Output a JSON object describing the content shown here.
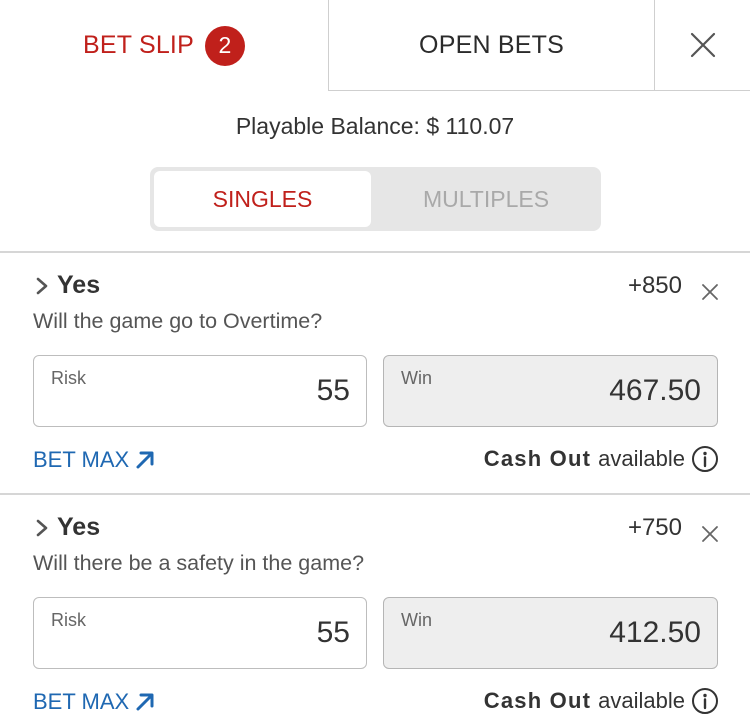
{
  "tabs": {
    "bet_slip_label": "BET SLIP",
    "bet_slip_count": "2",
    "open_bets_label": "OPEN BETS",
    "close_icon": "close-icon"
  },
  "balance": {
    "text": "Playable Balance: $ 110.07"
  },
  "mode_toggle": {
    "singles_label": "SINGLES",
    "multiples_label": "MULTIPLES",
    "selected": "SINGLES"
  },
  "bets": [
    {
      "selection": "Yes",
      "odds": "+850",
      "question": "Will the game go to Overtime?",
      "risk_label": "Risk",
      "risk_value": "55",
      "win_label": "Win",
      "win_value": "467.50",
      "bet_max_label": "BET MAX",
      "cash_out_bold": "Cash Out",
      "cash_out_rest": "available"
    },
    {
      "selection": "Yes",
      "odds": "+750",
      "question": "Will there be a safety in the game?",
      "risk_label": "Risk",
      "risk_value": "55",
      "win_label": "Win",
      "win_value": "412.50",
      "bet_max_label": "BET MAX",
      "cash_out_bold": "Cash Out",
      "cash_out_rest": "available"
    }
  ],
  "colors": {
    "accent_red": "#c0201b",
    "link_blue": "#1f68b2",
    "muted_gray": "#a9a9a9"
  }
}
